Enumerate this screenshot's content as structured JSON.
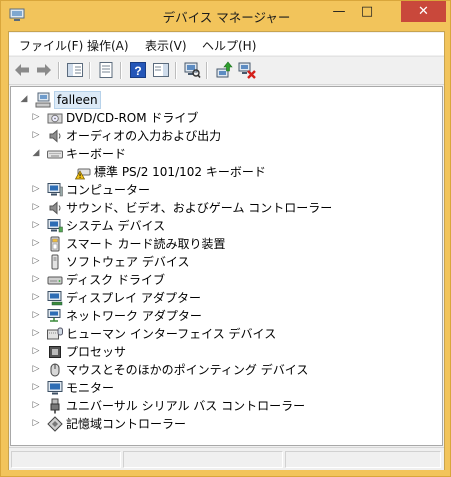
{
  "window": {
    "title": "デバイス マネージャー",
    "accent_color": "#f2c45b",
    "close_color": "#c9483b",
    "controls": {
      "minimize": "—",
      "maximize": "□",
      "close": "✕"
    }
  },
  "menubar": {
    "items": [
      {
        "label": "ファイル(F)"
      },
      {
        "label": "操作(A)"
      },
      {
        "label": "表示(V)"
      },
      {
        "label": "ヘルプ(H)"
      }
    ]
  },
  "toolbar": {
    "buttons": [
      {
        "icon": "back-arrow-icon"
      },
      {
        "icon": "forward-arrow-icon"
      },
      {
        "icon": "show-hide-console-tree-icon"
      },
      {
        "icon": "properties-icon"
      },
      {
        "icon": "help-icon"
      },
      {
        "icon": "action-pane-icon"
      },
      {
        "icon": "scan-hardware-icon"
      },
      {
        "icon": "update-driver-icon"
      },
      {
        "icon": "uninstall-device-icon"
      }
    ]
  },
  "tree": {
    "root": {
      "label": "falleen",
      "expanded": true
    },
    "categories": [
      {
        "label": "DVD/CD-ROM ドライブ",
        "icon": "dvd-drive-icon",
        "expanded": false
      },
      {
        "label": "オーディオの入力および出力",
        "icon": "speaker-icon",
        "expanded": false
      },
      {
        "label": "キーボード",
        "icon": "keyboard-icon",
        "expanded": true,
        "children": [
          {
            "label": "標準 PS/2 101/102 キーボード",
            "icon": "warning-keyboard-icon"
          }
        ]
      },
      {
        "label": "コンピューター",
        "icon": "computer-icon",
        "expanded": false
      },
      {
        "label": "サウンド、ビデオ、およびゲーム コントローラー",
        "icon": "speaker-icon",
        "expanded": false
      },
      {
        "label": "システム デバイス",
        "icon": "system-device-icon",
        "expanded": false
      },
      {
        "label": "スマート カード読み取り装置",
        "icon": "smart-card-reader-icon",
        "expanded": false
      },
      {
        "label": "ソフトウェア デバイス",
        "icon": "software-device-icon",
        "expanded": false
      },
      {
        "label": "ディスク ドライブ",
        "icon": "disk-drive-icon",
        "expanded": false
      },
      {
        "label": "ディスプレイ アダプター",
        "icon": "display-adapter-icon",
        "expanded": false
      },
      {
        "label": "ネットワーク アダプター",
        "icon": "network-adapter-icon",
        "expanded": false
      },
      {
        "label": "ヒューマン インターフェイス デバイス",
        "icon": "hid-icon",
        "expanded": false
      },
      {
        "label": "プロセッサ",
        "icon": "processor-icon",
        "expanded": false
      },
      {
        "label": "マウスとそのほかのポインティング デバイス",
        "icon": "mouse-icon",
        "expanded": false
      },
      {
        "label": "モニター",
        "icon": "monitor-icon",
        "expanded": false
      },
      {
        "label": "ユニバーサル シリアル バス コントローラー",
        "icon": "usb-icon",
        "expanded": false
      },
      {
        "label": "記憶域コントローラー",
        "icon": "storage-controller-icon",
        "expanded": false
      }
    ]
  }
}
